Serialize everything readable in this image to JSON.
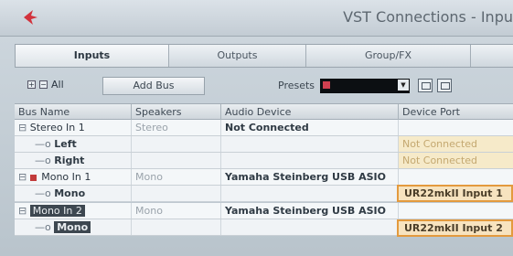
{
  "window": {
    "title": "VST Connections - Inpu"
  },
  "tabs": [
    {
      "label": "Inputs",
      "active": true
    },
    {
      "label": "Outputs",
      "active": false
    },
    {
      "label": "Group/FX",
      "active": false
    }
  ],
  "toolbar": {
    "all_label": "All",
    "add_bus_label": "Add Bus",
    "presets_label": "Presets",
    "presets_value": ""
  },
  "table": {
    "columns": [
      "Bus Name",
      "Speakers",
      "Audio Device",
      "Device Port"
    ],
    "rows": [
      {
        "name": "Stereo In 1",
        "speakers": "Stereo",
        "device": "Not Connected",
        "port": ""
      },
      {
        "name": "Left",
        "speakers": "",
        "device": "",
        "port": "Not Connected"
      },
      {
        "name": "Right",
        "speakers": "",
        "device": "",
        "port": "Not Connected"
      },
      {
        "name": "Mono In 1",
        "speakers": "Mono",
        "device": "Yamaha Steinberg USB ASIO",
        "port": ""
      },
      {
        "name": "Mono",
        "speakers": "",
        "device": "",
        "port": "UR22mkII Input 1"
      },
      {
        "name": "Mono In 2",
        "speakers": "Mono",
        "device": "Yamaha Steinberg USB ASIO",
        "port": ""
      },
      {
        "name": "Mono",
        "speakers": "",
        "device": "",
        "port": "UR22mkII Input 2"
      }
    ]
  },
  "colors": {
    "highlight_border": "#e39a3e",
    "not_connected_bg": "#f6eac9",
    "selected_bg": "#3d4750"
  }
}
